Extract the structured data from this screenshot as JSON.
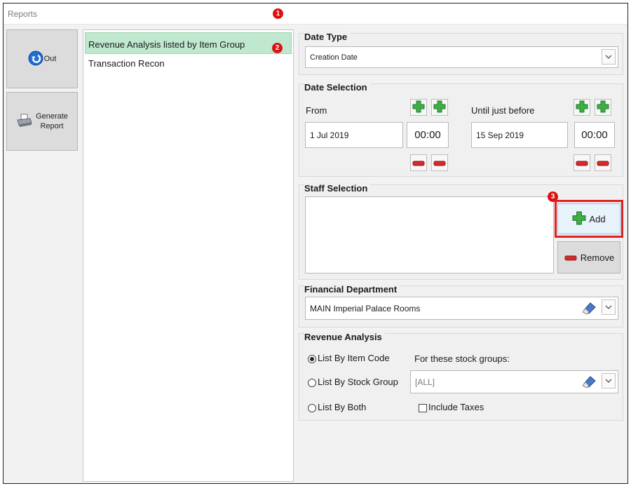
{
  "window": {
    "title": "Reports"
  },
  "badges": {
    "b1": "1",
    "b2": "2",
    "b3": "3"
  },
  "sidebar": {
    "out_label": "Out",
    "generate_line1": "Generate",
    "generate_line2": "Report"
  },
  "report_list": {
    "items": [
      "Revenue Analysis listed by Item Group",
      "Transaction Recon"
    ]
  },
  "date_type": {
    "title": "Date Type",
    "value": "Creation Date"
  },
  "date_selection": {
    "title": "Date Selection",
    "from_label": "From",
    "from_date": "1 Jul 2019",
    "from_time": "00:00",
    "until_label": "Until just before",
    "until_date": "15 Sep 2019",
    "until_time": "00:00"
  },
  "staff_selection": {
    "title": "Staff Selection",
    "add_label": "Add",
    "remove_label": "Remove"
  },
  "financial_department": {
    "title": "Financial Department",
    "value": "MAIN Imperial Palace Rooms"
  },
  "revenue_analysis": {
    "title": "Revenue Analysis",
    "option_item_code": "List By Item Code",
    "option_stock_group": "List By Stock Group",
    "option_both": "List By Both",
    "stock_groups_label": "For these stock groups:",
    "stock_groups_value": "[ALL]",
    "include_taxes_label": "Include Taxes",
    "selected_option": "List By Item Code",
    "include_taxes_checked": false
  },
  "colors": {
    "accent_red": "#dd1111",
    "selected_row": "#bfe8cf",
    "plus_green": "#3cb043",
    "minus_red": "#d62b2b"
  }
}
